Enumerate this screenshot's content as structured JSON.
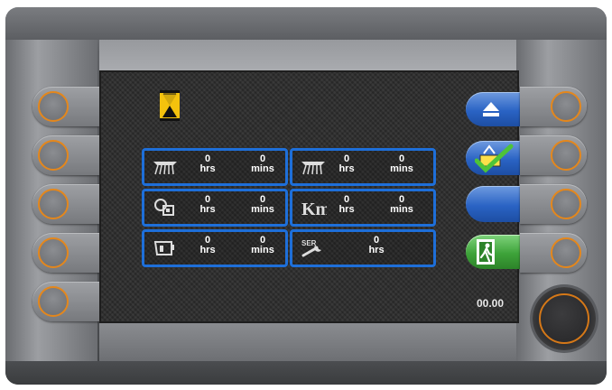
{
  "display": {
    "clock": "00.00"
  },
  "panels": [
    {
      "id": "p1",
      "icon": "brush-icon",
      "hours": "0",
      "hours_unit": "hrs",
      "mins": "0",
      "mins_unit": "mins"
    },
    {
      "id": "p2",
      "icon": "brush-icon",
      "hours": "0",
      "hours_unit": "hrs",
      "mins": "0",
      "mins_unit": "mins"
    },
    {
      "id": "p3",
      "icon": "engine-icon",
      "hours": "0",
      "hours_unit": "hrs",
      "mins": "0",
      "mins_unit": "mins"
    },
    {
      "id": "p4",
      "icon": "km-icon",
      "icon_text": "Km",
      "hours": "0",
      "hours_unit": "hrs",
      "mins": "0",
      "mins_unit": "mins"
    },
    {
      "id": "p5",
      "icon": "hopper-icon",
      "hours": "0",
      "hours_unit": "hrs",
      "mins": "0",
      "mins_unit": "mins"
    },
    {
      "id": "p6",
      "icon": "service-wrench-icon",
      "icon_text": "SER",
      "hours": "0",
      "hours_unit": "hrs"
    }
  ],
  "softkeys_right": [
    {
      "name": "eject-icon",
      "color": "blue"
    },
    {
      "name": "confirm-icon",
      "color": "blue"
    },
    {
      "name": "blank",
      "color": "blue"
    },
    {
      "name": "exit-icon",
      "color": "green"
    }
  ],
  "colors": {
    "panel_border": "#1e6fd9",
    "ring_orange": "#e4871c",
    "hourglass_yellow": "#f4c20d"
  }
}
